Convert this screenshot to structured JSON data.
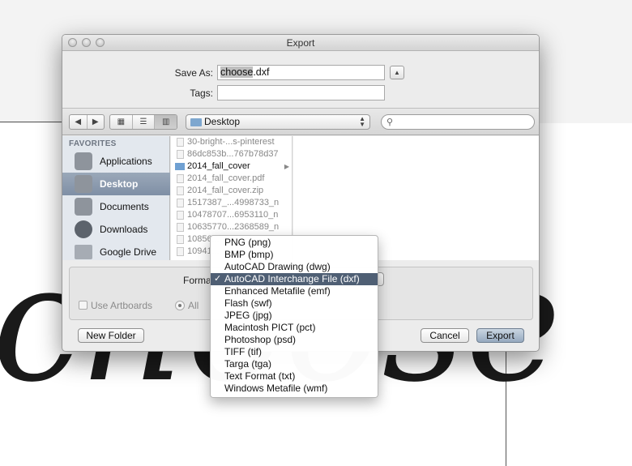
{
  "dialog": {
    "title": "Export",
    "save_as_label": "Save As:",
    "save_as_selected": "choose",
    "save_as_rest": ".dxf",
    "tags_label": "Tags:",
    "tags_value": "",
    "expand_icon": "▲"
  },
  "toolbar": {
    "back": "◀",
    "forward": "▶",
    "view_icons": "▦",
    "view_list": "☰",
    "view_columns": "▥",
    "location": "Desktop",
    "search_icon": "⚲",
    "search_value": ""
  },
  "sidebar": {
    "heading": "FAVORITES",
    "items": [
      {
        "label": "Applications",
        "icon": "applications-icon"
      },
      {
        "label": "Desktop",
        "icon": "desktop-icon",
        "selected": true
      },
      {
        "label": "Documents",
        "icon": "documents-icon"
      },
      {
        "label": "Downloads",
        "icon": "downloads-icon"
      },
      {
        "label": "Google Drive",
        "icon": "folder-icon"
      }
    ]
  },
  "files": [
    "30-bright-...s-pinterest",
    "86dc853b...767b78d37",
    "2014_fall_cover",
    "2014_fall_cover.pdf",
    "2014_fall_cover.zip",
    "1517387_...4998733_n",
    "10478707...6953110_n",
    "10635770...2368589_n",
    "10856...",
    "10941..."
  ],
  "options": {
    "format_label": "Format",
    "use_artboards_label": "Use Artboards",
    "all_label": "All"
  },
  "buttons": {
    "new_folder": "New Folder",
    "cancel": "Cancel",
    "export": "Export"
  },
  "format_menu": {
    "items": [
      "PNG (png)",
      "BMP (bmp)",
      "AutoCAD Drawing (dwg)",
      "AutoCAD Interchange File (dxf)",
      "Enhanced Metafile (emf)",
      "Flash (swf)",
      "JPEG (jpg)",
      "Macintosh PICT (pct)",
      "Photoshop (psd)",
      "TIFF (tif)",
      "Targa (tga)",
      "Text Format (txt)",
      "Windows Metafile (wmf)"
    ],
    "selected_index": 3,
    "check_mark": "✓"
  },
  "colors": {
    "menu_highlight": "#4f5f74",
    "sidebar_selected": "#8797ab"
  }
}
